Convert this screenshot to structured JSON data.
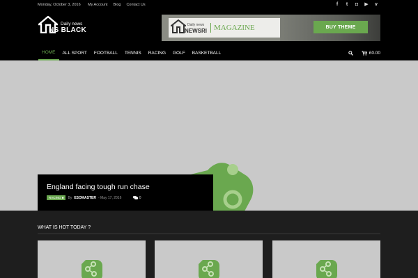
{
  "topbar": {
    "date": "Monday, October 3, 2016",
    "links": [
      "My Account",
      "Blog",
      "Contact Us"
    ],
    "social": [
      {
        "icon": "facebook-icon",
        "glyph": "f"
      },
      {
        "icon": "twitter-icon",
        "glyph": "t"
      },
      {
        "icon": "instagram-icon",
        "glyph": "◘"
      },
      {
        "icon": "youtube-icon",
        "glyph": "▶"
      },
      {
        "icon": "vimeo-icon",
        "glyph": "v"
      }
    ]
  },
  "logo": {
    "tagline": "Daily news",
    "name": "NS BLACK"
  },
  "banner": {
    "tagline": "Daily news",
    "brand": "NEWSRI",
    "magazine": "MAGAZINE",
    "button": "BUY THEME"
  },
  "nav": {
    "items": [
      "HOME",
      "ALL SPORT",
      "FOOTBALL",
      "TENNIS",
      "RACING",
      "GOLF",
      "BASKETBALL"
    ],
    "active_index": 0,
    "search_icon": "search-icon",
    "cart_icon": "cart-icon",
    "cart_total": "£0.00"
  },
  "hero": {
    "title": "England facing tough run chase",
    "category": "RACING",
    "by": "By",
    "author": "ESOMASTER",
    "date": "- May 17, 2016",
    "comments": "0"
  },
  "section": {
    "title": "WHAT IS HOT TODAY ?"
  },
  "cards": [
    {},
    {},
    {}
  ],
  "colors": {
    "accent": "#6aa84f",
    "placeholder": "#c9c9c9",
    "dark": "#1e1e1e"
  }
}
